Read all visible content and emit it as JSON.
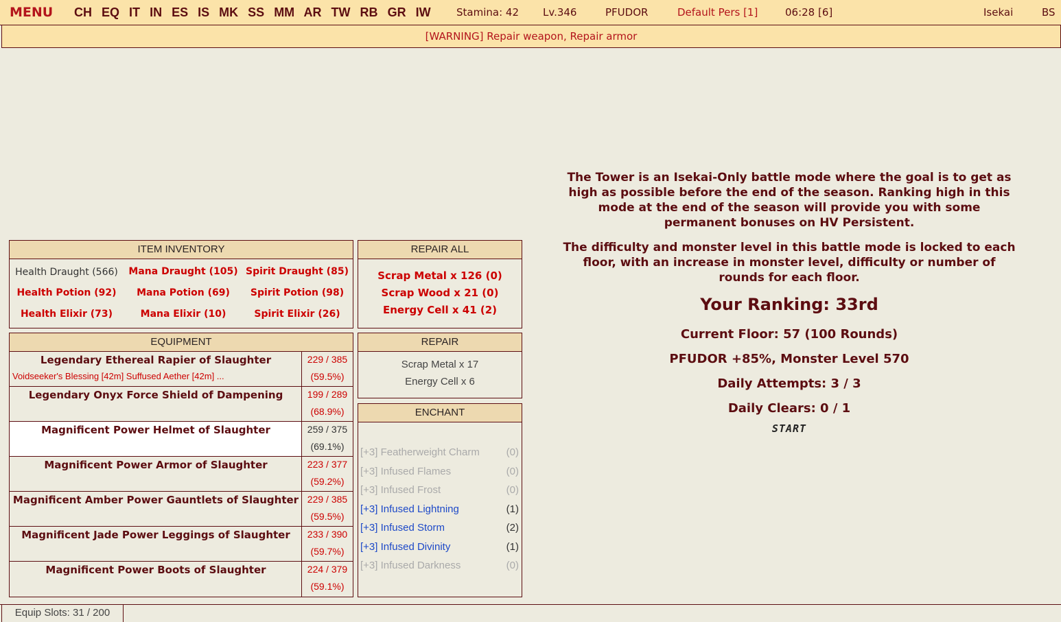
{
  "topbar": {
    "menu": "MENU",
    "nav": [
      "CH",
      "EQ",
      "IT",
      "IN",
      "ES",
      "IS",
      "MK",
      "SS",
      "MM",
      "AR",
      "TW",
      "RB",
      "GR",
      "IW"
    ],
    "stamina": "Stamina: 42",
    "level": "Lv.346",
    "difficulty": "PFUDOR",
    "persona": "Default Pers [1]",
    "clock": "06:28 [6]",
    "world": "Isekai",
    "bs": "BS"
  },
  "warning": "[WARNING] Repair weapon, Repair armor",
  "inventory": {
    "title": "ITEM INVENTORY",
    "items": [
      {
        "label": "Health Draught (566)",
        "highlight": false
      },
      {
        "label": "Mana Draught (105)",
        "highlight": true
      },
      {
        "label": "Spirit Draught (85)",
        "highlight": true
      },
      {
        "label": "Health Potion (92)",
        "highlight": true
      },
      {
        "label": "Mana Potion (69)",
        "highlight": true
      },
      {
        "label": "Spirit Potion (98)",
        "highlight": true
      },
      {
        "label": "Health Elixir (73)",
        "highlight": true
      },
      {
        "label": "Mana Elixir (10)",
        "highlight": true
      },
      {
        "label": "Spirit Elixir (26)",
        "highlight": true
      }
    ]
  },
  "repair_all": {
    "title": "REPAIR ALL",
    "lines": [
      "Scrap Metal x 126 (0)",
      "Scrap Wood x 21 (0)",
      "Energy Cell x 41 (2)"
    ]
  },
  "equipment": {
    "title": "EQUIPMENT",
    "items": [
      {
        "name": "Legendary Ethereal Rapier of Slaughter",
        "enchants": "Voidseeker's Blessing [42m]  Suffused Aether [42m]  ...",
        "condition": "229 / 385",
        "percent": "(59.5%)"
      },
      {
        "name": "Legendary Onyx Force Shield of Dampening",
        "enchants": "",
        "condition": "199 / 289",
        "percent": "(68.9%)"
      },
      {
        "name": "Magnificent Power Helmet of Slaughter",
        "enchants": "",
        "condition": "259 / 375",
        "percent": "(69.1%)"
      },
      {
        "name": "Magnificent Power Armor of Slaughter",
        "enchants": "",
        "condition": "223 / 377",
        "percent": "(59.2%)"
      },
      {
        "name": "Magnificent Amber Power Gauntlets of Slaughter",
        "enchants": "",
        "condition": "229 / 385",
        "percent": "(59.5%)"
      },
      {
        "name": "Magnificent Jade Power Leggings of Slaughter",
        "enchants": "",
        "condition": "233 / 390",
        "percent": "(59.7%)"
      },
      {
        "name": "Magnificent Power Boots of Slaughter",
        "enchants": "",
        "condition": "224 / 379",
        "percent": "(59.1%)"
      }
    ]
  },
  "repair": {
    "title": "REPAIR",
    "lines": [
      "Scrap Metal x 17",
      "Energy Cell x 6"
    ]
  },
  "enchant": {
    "title": "ENCHANT",
    "items": [
      {
        "name": "[+3] Featherweight Charm",
        "count": "(0)",
        "available": false
      },
      {
        "name": "[+3] Infused Flames",
        "count": "(0)",
        "available": false
      },
      {
        "name": "[+3] Infused Frost",
        "count": "(0)",
        "available": false
      },
      {
        "name": "[+3] Infused Lightning",
        "count": "(1)",
        "available": true
      },
      {
        "name": "[+3] Infused Storm",
        "count": "(2)",
        "available": true
      },
      {
        "name": "[+3] Infused Divinity",
        "count": "(1)",
        "available": true
      },
      {
        "name": "[+3] Infused Darkness",
        "count": "(0)",
        "available": false
      }
    ]
  },
  "tower": {
    "description1": "The Tower is an Isekai-Only battle mode where the goal is to get as high as possible before the end of the season. Ranking high in this mode at the end of the season will provide you with some permanent bonuses on HV Persistent.",
    "description2": "The difficulty and monster level in this battle mode is locked to each floor, with an increase in monster level, difficulty or number of rounds for each floor.",
    "ranking": "Your Ranking: 33rd",
    "current_floor": "Current Floor: 57 (100 Rounds)",
    "modifier": "PFUDOR +85%, Monster Level 570",
    "daily_attempts": "Daily Attempts: 3 / 3",
    "daily_clears": "Daily Clears: 0 / 1",
    "start": "START"
  },
  "status": {
    "equip_slots": "Equip Slots: 31 / 200"
  },
  "colors": {
    "bar_bg": "#fbe3a9",
    "panel_head_bg": "#edd9b0",
    "page_bg": "#edebdf",
    "text_dark": "#5c0d11",
    "alert_red": "#cc0000",
    "enchant_blue": "#1d49c8"
  }
}
